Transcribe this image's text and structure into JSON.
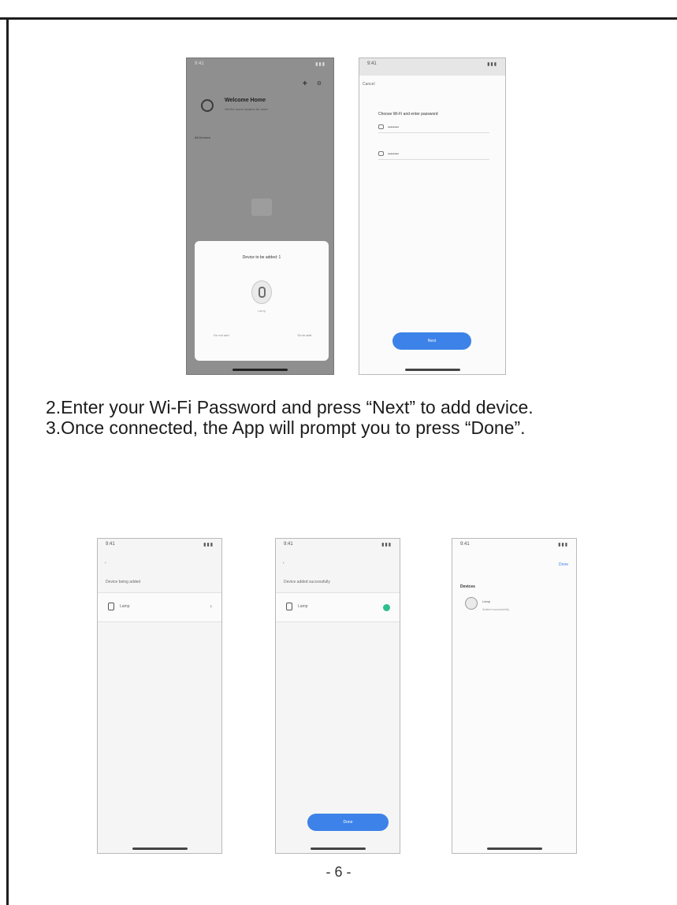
{
  "screens_top": {
    "phone_a": {
      "status_time": "9:41",
      "status_signal": "▮▮▮",
      "home_title": "Welcome Home",
      "home_subtitle": "Set the home location for more",
      "section_label": "All Devices",
      "top_icons": "✚ ⚙",
      "popup_title": "Device to be added: 1",
      "popup_device_name": "Lamp",
      "popup_cancel": "Do not add",
      "popup_add": "Go to add"
    },
    "phone_b": {
      "status_time": "9:41",
      "status_signal": "▮▮▮",
      "back": "Cancel",
      "wifi_title": "Choose Wi-Fi and enter password",
      "field_ssid": "••••••••",
      "field_password": "••••••••",
      "next_button": "Next"
    }
  },
  "instructions": {
    "step2": "2.Enter your Wi-Fi Password and press “Next” to add device.",
    "step3": "3.Once connected, the App will prompt you to press “Done”."
  },
  "screens_bottom": {
    "phone_1": {
      "status_time": "9:41",
      "status_signal": "▮▮▮",
      "back": "‹",
      "hint": "Device being added",
      "device_name": "Lamp",
      "chevron": "›"
    },
    "phone_2": {
      "status_time": "9:41",
      "status_signal": "▮▮▮",
      "back": "‹",
      "hint": "Device added successfully",
      "device_name": "Lamp",
      "done_button": "Done"
    },
    "phone_3": {
      "status_time": "9:41",
      "status_signal": "▮▮▮",
      "done": "Done",
      "section": "Devices",
      "device_name": "Lamp",
      "device_sub": "Added successfully"
    }
  },
  "page_number": "- 6 -"
}
